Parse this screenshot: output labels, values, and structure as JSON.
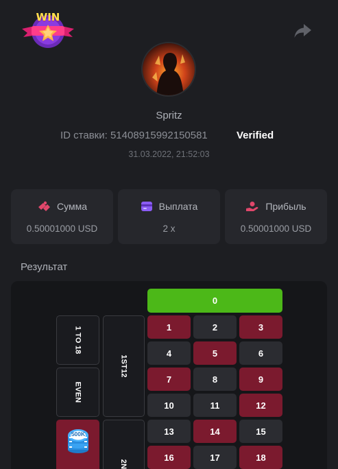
{
  "header": {
    "logo_text": "WIN",
    "logo_icon": "win-badge-logo",
    "share_icon": "share-icon"
  },
  "profile": {
    "username": "Spritz",
    "bet_id_label": "ID ставки: 51408915992150581",
    "verified_label": "Verified",
    "datetime": "31.03.2022, 21:52:03"
  },
  "stats": [
    {
      "icon": "coins-icon",
      "label": "Сумма",
      "value": "0.50001000 USD",
      "color": "#e0476b"
    },
    {
      "icon": "wallet-icon",
      "label": "Выплата",
      "value": "2 x",
      "color": "#8b5cf6"
    },
    {
      "icon": "hand-money-icon",
      "label": "Прибыль",
      "value": "0.50001000 USD",
      "color": "#e0476b"
    }
  ],
  "result": {
    "title": "Результат",
    "zero_label": "0",
    "side_bets": {
      "low": "1 TO 18",
      "even": "EVEN",
      "dozen1": "1ST12",
      "dozen2": "2N"
    },
    "chip_label": "500K",
    "numbers": [
      [
        "1",
        "2",
        "3"
      ],
      [
        "4",
        "5",
        "6"
      ],
      [
        "7",
        "8",
        "9"
      ],
      [
        "10",
        "11",
        "12"
      ],
      [
        "13",
        "14",
        "15"
      ],
      [
        "16",
        "17",
        "18"
      ]
    ]
  },
  "colors": {
    "background": "#1d1e22",
    "card": "#26272c",
    "red": "#7b1a2e",
    "black": "#2b2c31",
    "green": "#4cb818"
  }
}
